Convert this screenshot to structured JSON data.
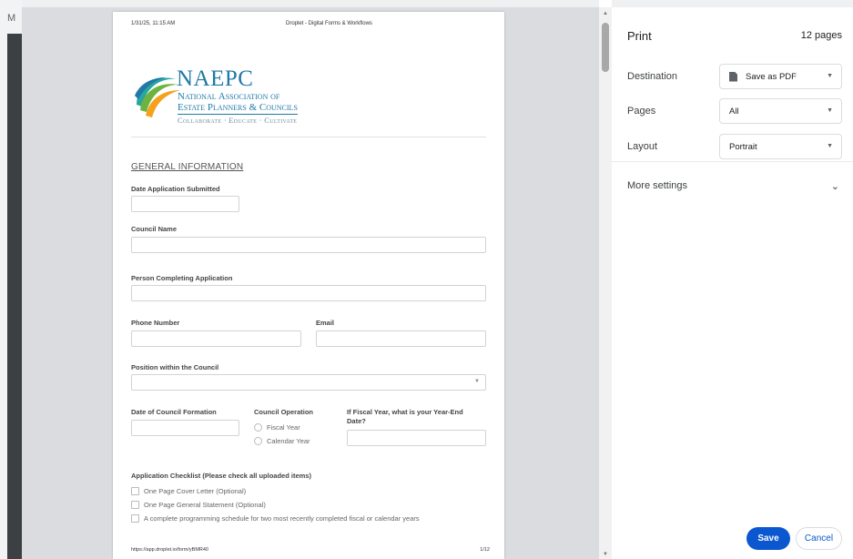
{
  "window": {
    "left_edge_letter": "M"
  },
  "preview": {
    "header_date": "1/31/25, 11:15 AM",
    "header_title": "Droplet - Digital Forms & Workflows",
    "footer_url": "https://app.droplet.io/form/yBMR40",
    "footer_page": "1/12",
    "logo": {
      "acronym": "NAEPC",
      "line1": "National Association of",
      "line2": "Estate Planners & Councils",
      "tagline": "Collaborate · Educate · Cultivate",
      "colors": {
        "blue": "#1f7aa6",
        "green": "#6db33f",
        "orange": "#f4a11b",
        "teal": "#2aa6a0"
      }
    },
    "section_title": "GENERAL INFORMATION",
    "fields": {
      "date_submitted": "Date Application Submitted",
      "council_name": "Council Name",
      "person_completing": "Person Completing Application",
      "phone": "Phone Number",
      "email": "Email",
      "position": "Position within the Council",
      "formation_date": "Date of Council Formation",
      "council_operation": "Council Operation",
      "fiscal_year_end": "If Fiscal Year, what is your Year-End Date?"
    },
    "operation_options": [
      "Fiscal Year",
      "Calendar Year"
    ],
    "checklist_title": "Application Checklist (Please check all uploaded items)",
    "checklist_items": [
      "One Page Cover Letter (Optional)",
      "One Page General Statement (Optional)",
      "A complete programming schedule for two most recently completed fiscal or calendar years"
    ]
  },
  "settings": {
    "title": "Print",
    "page_count": "12 pages",
    "destination_label": "Destination",
    "destination_value": "Save as PDF",
    "pages_label": "Pages",
    "pages_value": "All",
    "layout_label": "Layout",
    "layout_value": "Portrait",
    "more_settings": "More settings",
    "save_label": "Save",
    "cancel_label": "Cancel",
    "accent_color": "#0b57d0"
  }
}
